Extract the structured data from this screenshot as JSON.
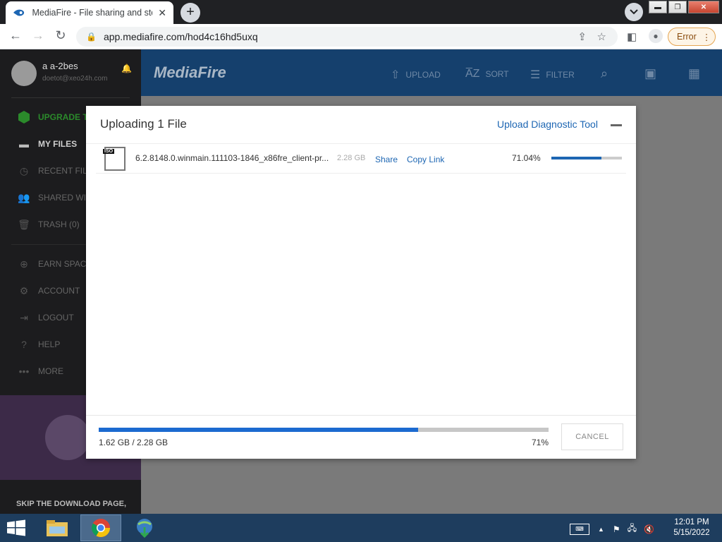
{
  "browser": {
    "tab_title": "MediaFire - File sharing and stora",
    "url": "app.mediafire.com/hod4c16hd5uxq",
    "error_label": "Error"
  },
  "sidebar": {
    "user_name": "a a-2bes",
    "user_email": "doetot@xeo24h.com",
    "items": [
      {
        "label": "UPGRADE TO",
        "icon": "upgrade-icon"
      },
      {
        "label": "MY FILES",
        "icon": "folder-icon"
      },
      {
        "label": "RECENT FILE",
        "icon": "clock-icon"
      },
      {
        "label": "SHARED WIT",
        "icon": "people-icon"
      },
      {
        "label": "TRASH (0)",
        "icon": "trash-icon"
      },
      {
        "label": "EARN SPACE",
        "icon": "plus-circle-icon"
      },
      {
        "label": "ACCOUNT",
        "icon": "gear-icon"
      },
      {
        "label": "LOGOUT",
        "icon": "logout-icon"
      },
      {
        "label": "HELP",
        "icon": "help-icon"
      },
      {
        "label": "MORE",
        "icon": "more-icon"
      }
    ],
    "skip_text": "SKIP THE DOWNLOAD PAGE,"
  },
  "header": {
    "logo": "MediaFire",
    "upload": "UPLOAD",
    "sort": "SORT",
    "filter": "FILTER"
  },
  "modal": {
    "title": "Uploading 1 File",
    "diagnostic_link": "Upload Diagnostic Tool",
    "file": {
      "badge": "ISO",
      "name": "6.2.8148.0.winmain.111103-1846_x86fre_client-pr...",
      "size": "2.28 GB",
      "share": "Share",
      "copy_link": "Copy Link",
      "percent": "71.04%",
      "progress": 0.7104
    },
    "total": {
      "transferred": "1.62 GB / 2.28 GB",
      "percent": "71%",
      "progress": 0.7104
    },
    "cancel": "CANCEL"
  },
  "taskbar": {
    "time": "12:01 PM",
    "date": "5/15/2022"
  },
  "colors": {
    "accent_blue": "#1d66b3",
    "header_blue": "#15406d",
    "taskbar": "#1e3d5e"
  }
}
